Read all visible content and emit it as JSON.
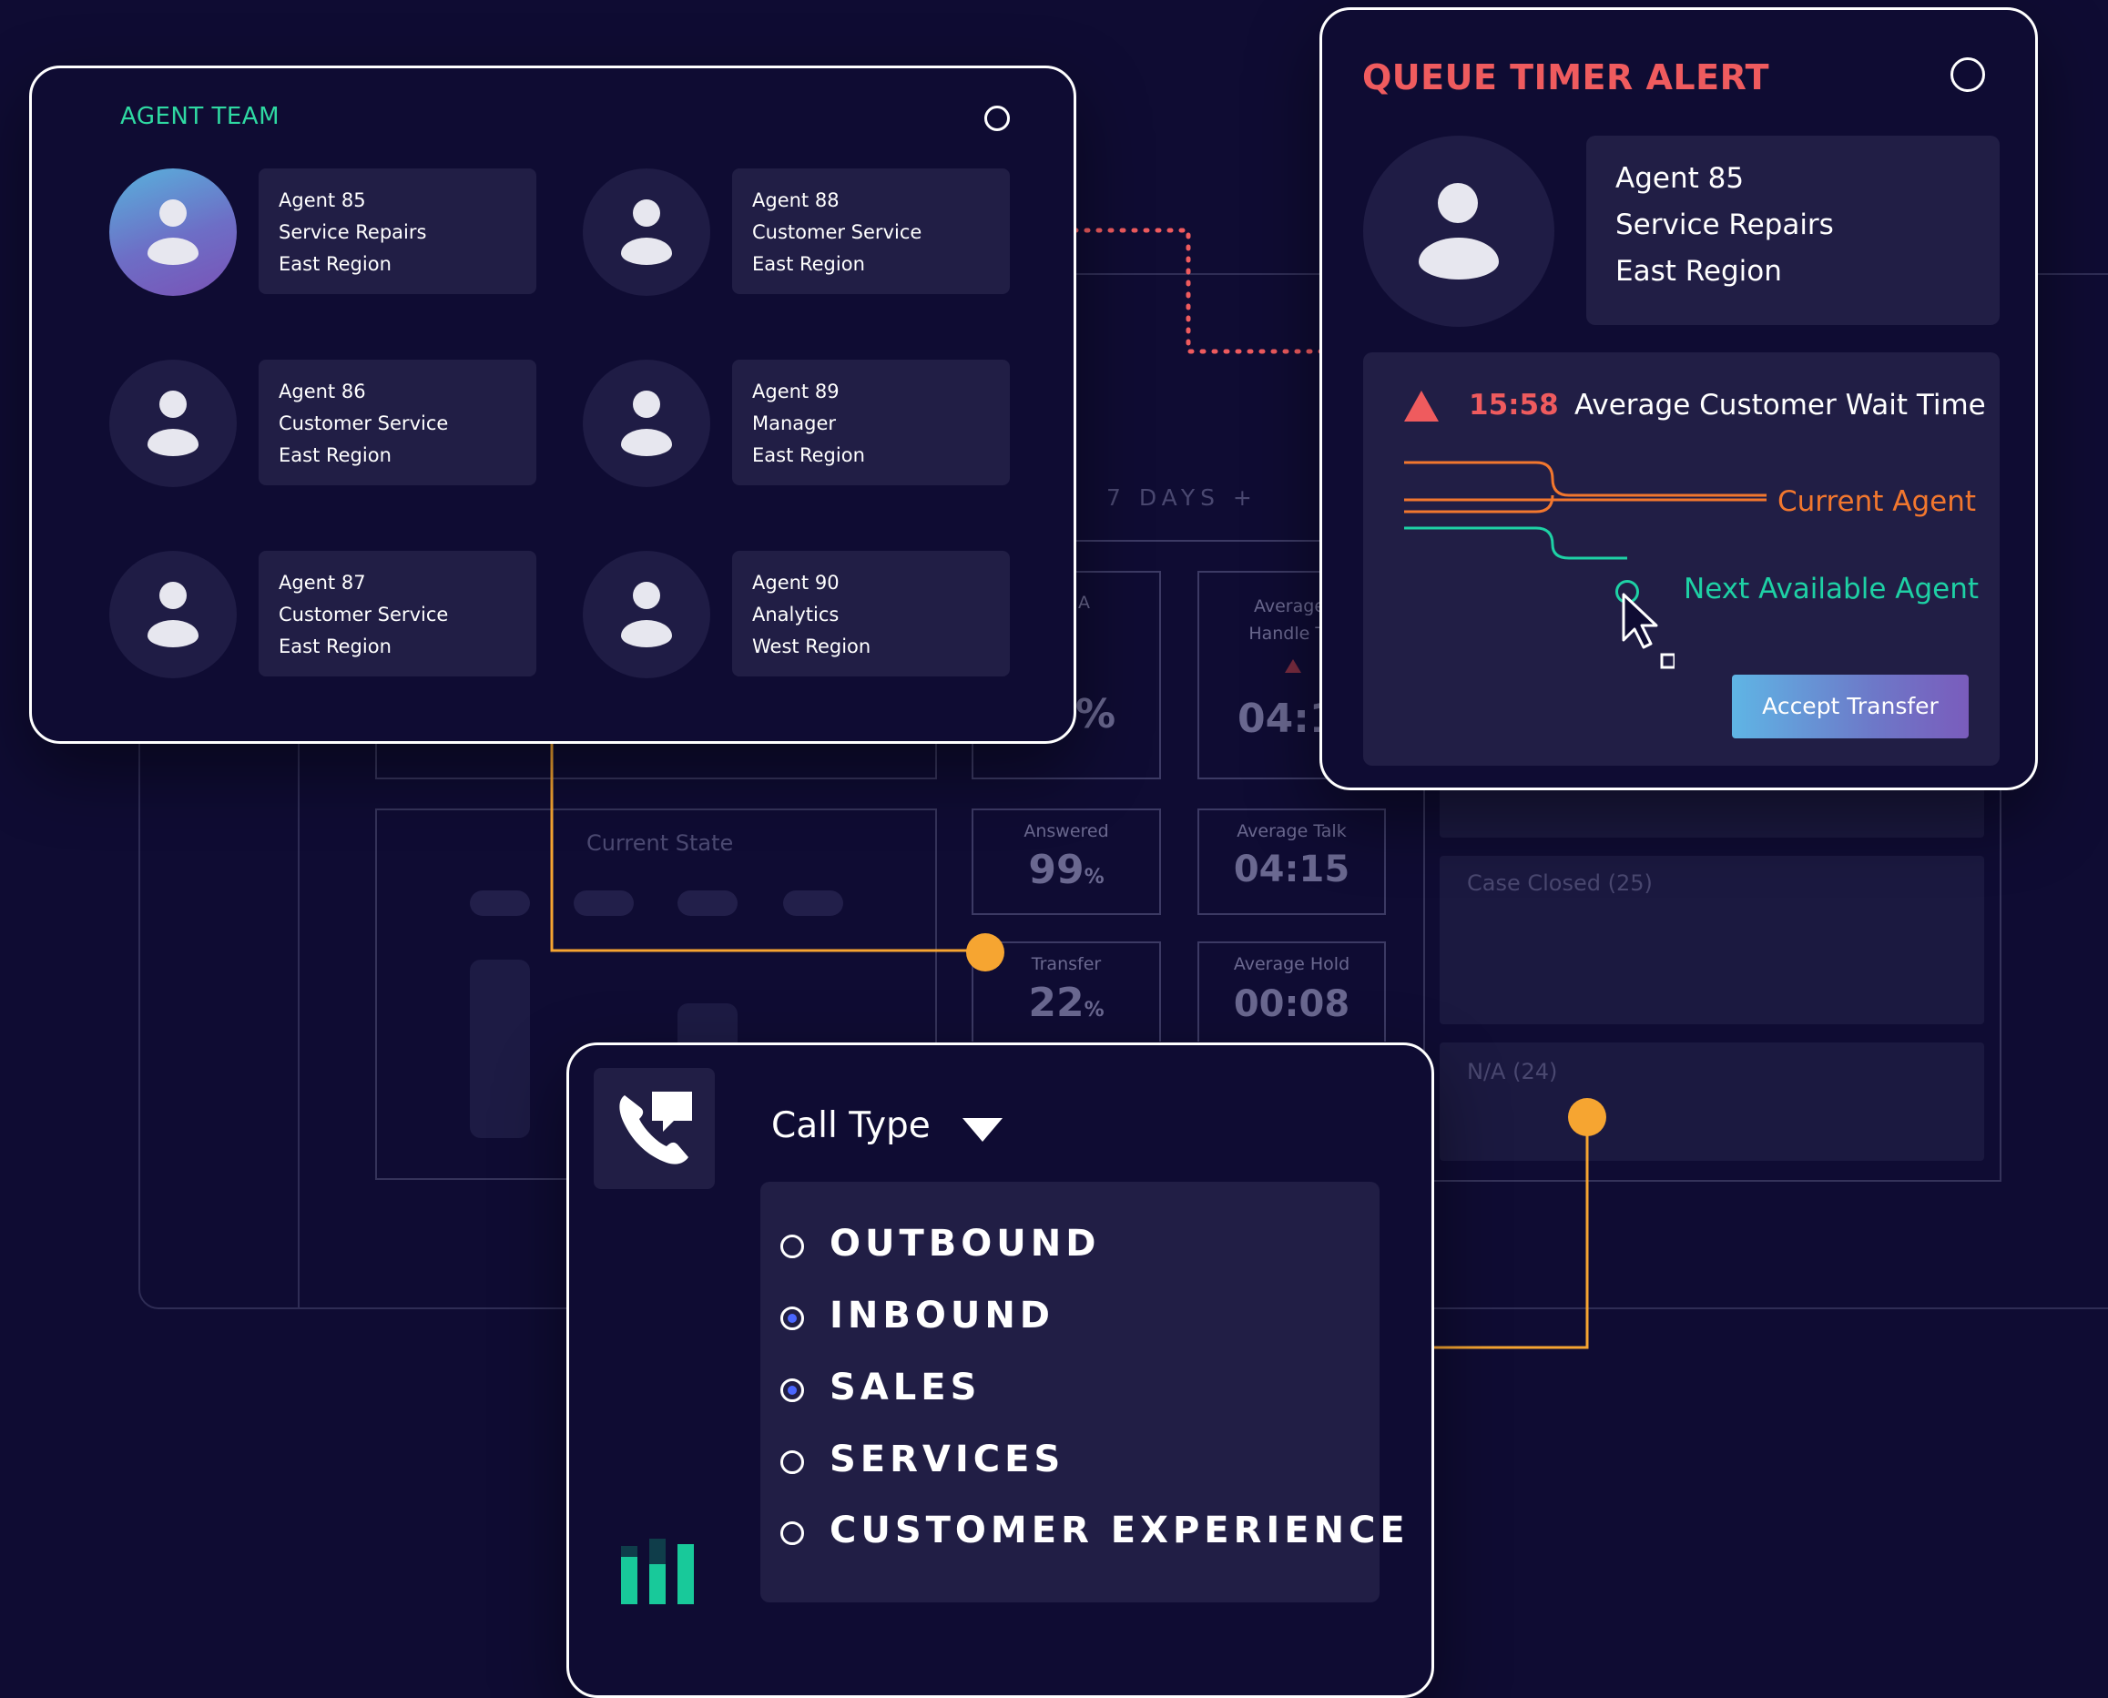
{
  "background_dashboard": {
    "range_label": "7 DAYS +",
    "current_state_label": "Current State",
    "partial_metric_1": {
      "label_fragment": "A",
      "value_fragment": "%"
    },
    "partial_metric_2": {
      "label_fragment": "Average Handle Ti",
      "value_fragment": "04:1"
    },
    "metrics": [
      {
        "label": "Answered",
        "value": "99",
        "unit": "%"
      },
      {
        "label": "Average Talk",
        "value": "04:15",
        "unit": ""
      },
      {
        "label": "Transfer",
        "value": "22",
        "unit": "%"
      },
      {
        "label": "Average Hold",
        "value": "00:08",
        "unit": ""
      }
    ],
    "case_closed_label": "Case Closed (25)",
    "na_label": "N/A (24)"
  },
  "agent_team": {
    "title": "AGENT TEAM",
    "agents": [
      {
        "name": "Agent 85",
        "role": "Service Repairs",
        "region": "East Region",
        "active": true
      },
      {
        "name": "Agent 88",
        "role": "Customer Service",
        "region": "East Region",
        "active": false
      },
      {
        "name": "Agent 86",
        "role": "Customer Service",
        "region": "East Region",
        "active": false
      },
      {
        "name": "Agent 89",
        "role": "Manager",
        "region": "East Region",
        "active": false
      },
      {
        "name": "Agent 87",
        "role": "Customer Service",
        "region": "East Region",
        "active": false
      },
      {
        "name": "Agent 90",
        "role": "Analytics",
        "region": "West Region",
        "active": false
      }
    ]
  },
  "queue_alert": {
    "title": "QUEUE TIMER ALERT",
    "agent": {
      "name": "Agent 85",
      "role": "Service Repairs",
      "region": "East Region"
    },
    "timer": "15:58",
    "metric_label": "Average Customer Wait Time",
    "current_agent_label": "Current Agent",
    "next_agent_label": "Next Available Agent",
    "accept_button": "Accept Transfer"
  },
  "call_type": {
    "title": "Call Type",
    "options": [
      {
        "label": "OUTBOUND",
        "selected": false
      },
      {
        "label": "INBOUND",
        "selected": true
      },
      {
        "label": "SALES",
        "selected": true
      },
      {
        "label": "SERVICES",
        "selected": false
      },
      {
        "label": "CUSTOMER EXPERIENCE",
        "selected": false
      }
    ]
  },
  "icons": {
    "phone_icon": "phone-transfer-icon",
    "chart_icon": "bar-chart-icon",
    "alert_icon": "warning-triangle-icon",
    "cursor_icon": "mouse-pointer-icon"
  },
  "colors": {
    "background": "#0f0c33",
    "alert_red": "#ef5b5e",
    "team_green": "#2fd9a2",
    "current_agent_orange": "#f2772e",
    "next_agent_teal": "#1ed1a5",
    "connector_orange": "#f6a531"
  }
}
